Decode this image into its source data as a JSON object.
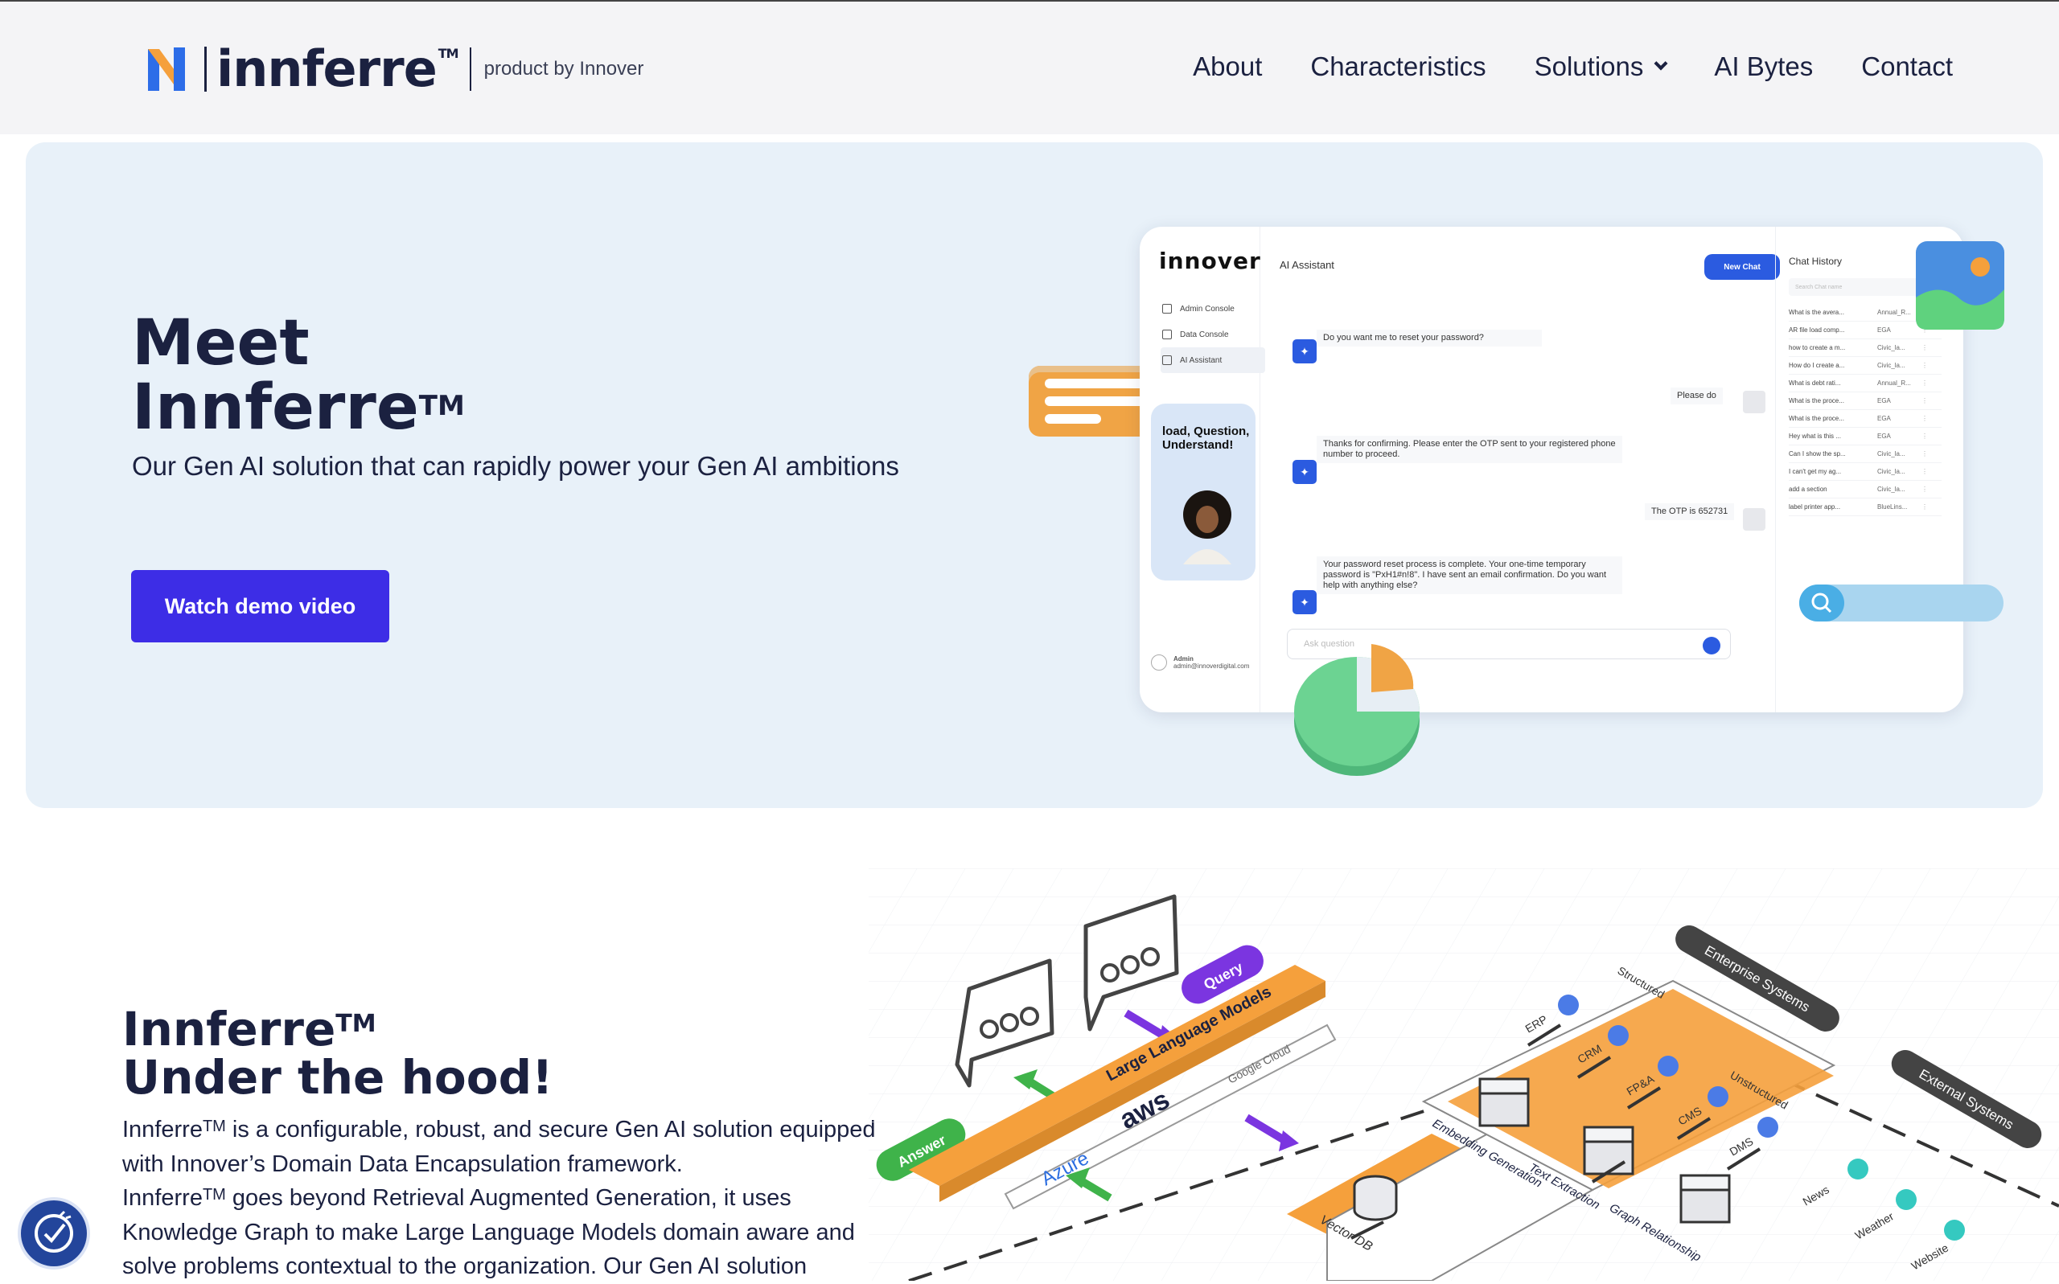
{
  "header": {
    "brand_word": "innferre",
    "brand_tm": "TM",
    "brand_tagline": "product by Innover",
    "nav": [
      {
        "label": "About"
      },
      {
        "label": "Characteristics"
      },
      {
        "label": "Solutions",
        "has_dropdown": true
      },
      {
        "label": "AI Bytes"
      },
      {
        "label": "Contact"
      }
    ]
  },
  "hero": {
    "title_line1": "Meet",
    "title_line2": "Innferre",
    "title_tm": "TM",
    "subtitle": "Our Gen AI solution that can rapidly power your Gen AI ambitions",
    "cta_label": "Watch demo video",
    "mock_app": {
      "brand": "innover",
      "menu": [
        "Admin Console",
        "Data Console",
        "AI Assistant"
      ],
      "card_text": "load, Question, Understand!",
      "admin_label": "Admin",
      "admin_email": "admin@innoverdigital.com",
      "header": "AI Assistant",
      "new_chat": "New Chat",
      "messages": [
        {
          "from": "bot",
          "text": "Do you want me to reset your password?"
        },
        {
          "from": "user",
          "text": "Please do"
        },
        {
          "from": "bot",
          "text": "Thanks for confirming. Please enter the OTP sent to your registered phone number to proceed."
        },
        {
          "from": "user",
          "text": "The OTP is 652731"
        },
        {
          "from": "bot",
          "text": "Your password reset process is complete. Your one-time temporary password is \"PxH1#n!8\". I have sent an email confirmation. Do you want help with anything else?"
        }
      ],
      "input_placeholder": "Ask question",
      "history_title": "Chat History",
      "history_search": "Search Chat name",
      "history": [
        {
          "q": "What is the avera...",
          "t": "Annual_R..."
        },
        {
          "q": "AR file load comp...",
          "t": "EGA"
        },
        {
          "q": "how to create a m...",
          "t": "Civic_la..."
        },
        {
          "q": "How do I create a...",
          "t": "Civic_la..."
        },
        {
          "q": "What is debt rati...",
          "t": "Annual_R..."
        },
        {
          "q": "What is the proce...",
          "t": "EGA"
        },
        {
          "q": "What is the proce...",
          "t": "EGA"
        },
        {
          "q": "Hey what is this ...",
          "t": "EGA"
        },
        {
          "q": "Can I show the sp...",
          "t": "Civic_la..."
        },
        {
          "q": "I can't get my ag...",
          "t": "Civic_la..."
        },
        {
          "q": "add a section",
          "t": "Civic_la..."
        },
        {
          "q": "label printer app...",
          "t": "BlueLins..."
        }
      ]
    }
  },
  "section2": {
    "title_line1": "Innferre",
    "title_tm": "TM",
    "title_line2": "Under the hood!",
    "body_p1_a": "Innferre",
    "body_p1_tm": "TM",
    "body_p1_b": " is a configurable, robust, and secure Gen AI solution equipped with Innover’s Domain Data Encapsulation framework.",
    "body_p2_a": "Innferre",
    "body_p2_tm": "TM",
    "body_p2_b": " goes beyond Retrieval Augmented Generation, it uses Knowledge Graph to make Large Language Models domain aware and solve problems contextual to the organization. Our Gen AI solution",
    "diagram": {
      "answer": "Answer",
      "query": "Query",
      "llm": "Large Language Models",
      "azure": "Azure",
      "aws": "aws",
      "google": "Google Cloud",
      "enterprise": "Enterprise Systems",
      "external": "External Systems",
      "structured": "Structured",
      "unstructured": "Unstructured",
      "erp": "ERP",
      "crm": "CRM",
      "fpa": "FP&A",
      "cms": "CMS",
      "dms": "DMS",
      "news": "News",
      "weather": "Weather",
      "website": "Website",
      "embedding": "Embedding Generation",
      "text_extraction": "Text Extraction",
      "graph": "Graph Relationship",
      "vector_db": "Vector DB"
    }
  },
  "colors": {
    "primary": "#3d2de6",
    "navy": "#1b2140",
    "hero_bg": "#e8f1f9",
    "orange": "#f5a03c",
    "green": "#3fb34a",
    "purple": "#7b35e0"
  }
}
